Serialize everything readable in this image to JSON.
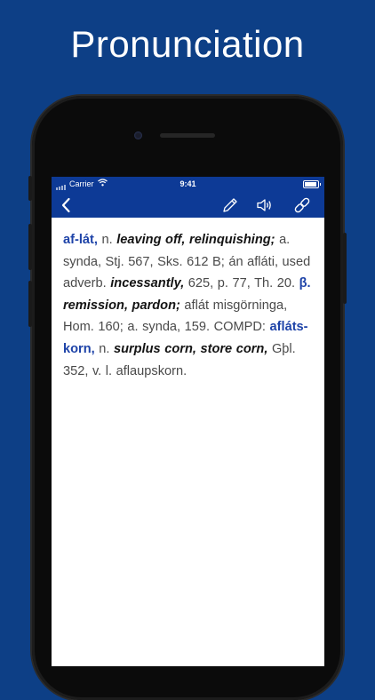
{
  "promo": {
    "title": "Pronunciation"
  },
  "status_bar": {
    "carrier": "Carrier",
    "time": "9:41"
  },
  "toolbar": {
    "back_icon": "chevron-left-icon",
    "edit_icon": "pencil-icon",
    "audio_icon": "speaker-icon",
    "link_icon": "link-icon"
  },
  "colors": {
    "background": "#0d3f86",
    "navbar": "#0d3a96",
    "headword": "#1e43a8"
  },
  "entry": {
    "headword": "af-lát,",
    "t1": " n. ",
    "d1": "leaving off, relinquishing;",
    "t2": " a. synda, Stj. 567, Sks. 612 B; án afláti, used adverb. ",
    "d2": "incessantly,",
    "t3": " 625, p. 77, Th. 20. ",
    "beta": "β.",
    "t4": " ",
    "d3": "remission, pardon;",
    "t5": " aflát misgörninga, Hom. 160; a. synda, 159. COMPD: ",
    "compound": "afláts-korn,",
    "t6": " n. ",
    "d4": "surplus corn, store corn,",
    "t7": " Gþl. 352, v. l. aflaupskorn."
  }
}
